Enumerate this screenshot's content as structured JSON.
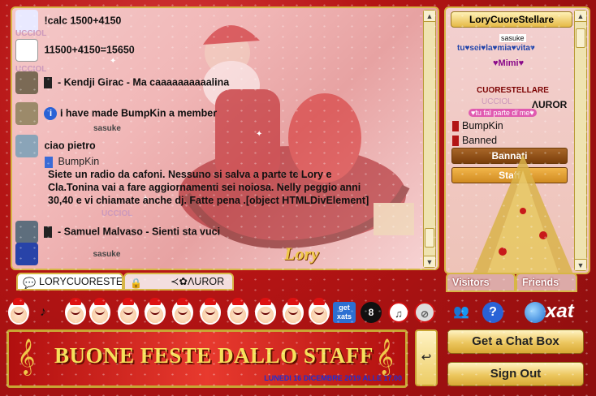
{
  "chat": {
    "messages": [
      {
        "text": "!calc 1500+4150"
      },
      {
        "text": "11500+4150=15650"
      },
      {
        "text": "- Kendji Girac - Ma caaaaaaaaaalina"
      },
      {
        "text": "I have made BumpKin a member"
      },
      {
        "text": "ciao pietro"
      },
      {
        "name": "BumpKin",
        "lines": [
          "Siete un radio da cafoni. Nessuno si salva a parte te Lory e",
          "Cla.Tonina vai a fare aggiornamenti sei noiosa. Nelly peggio anni",
          "30,40 e vi chiamate anche dj. Fatte pena .[object HTMLDivElement]"
        ]
      },
      {
        "text": "- Samuel Malvaso - Sienti sta vuci"
      }
    ],
    "name_tags": [
      "UCCIOL",
      "UCCIOL",
      "sasuke",
      "UCCIOL",
      "sasuke"
    ],
    "watermark": "Lory"
  },
  "tabs": [
    {
      "label": "LORYCUORESTELLARE",
      "active": true
    },
    {
      "label": "≺✿ΛUROR",
      "active": false
    }
  ],
  "userlist": {
    "title": "LoryCuoreStellare",
    "rows": [
      {
        "text": "sasuke"
      },
      {
        "text": "tu♥sei♥la♥mia♥vita♥"
      },
      {
        "text": "♥Mimi♥"
      },
      {
        "text": "CUORESTELLARE"
      },
      {
        "text": "UCCIOL"
      },
      {
        "text": "ΛUROR"
      },
      {
        "text": "♥tu fai parte di me♥"
      },
      {
        "text": "BumpKin"
      },
      {
        "text": "Banned"
      }
    ],
    "buttons": {
      "bannati": "Bannati",
      "staff": "Staff"
    },
    "tabs": {
      "visitors": "Visitors",
      "friends": "Friends"
    }
  },
  "toolbar": {
    "get_xats": "get xats",
    "brand": "xat"
  },
  "composer": {
    "banner": "BUONE FESTE DALLO STAFF",
    "date": "LUNEDI 16 DICEMBRE 2019  ALLE 17.00",
    "send": "↩"
  },
  "buttons": {
    "get_chat_box": "Get a Chat Box",
    "sign_out": "Sign Out"
  },
  "colors": {
    "frame": "#b41414",
    "gold": "#d7b646",
    "button": "#ecc65e",
    "bannati": "#8a4b12",
    "staff": "#d99a2b"
  }
}
